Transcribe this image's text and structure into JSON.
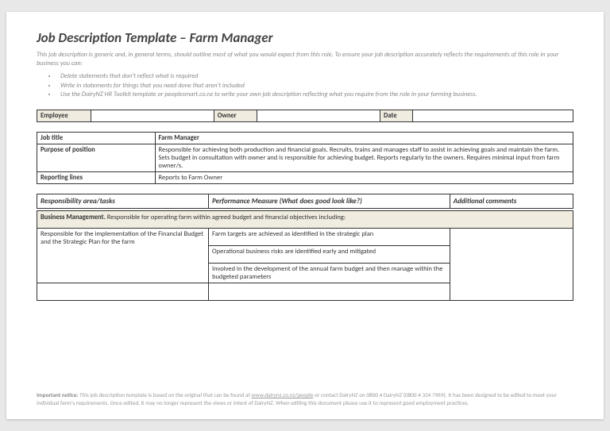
{
  "title": "Job Description Template – Farm Manager",
  "intro": "This job description is generic and, in general terms, should outline most of what you would expect from this role. To ensure your job description accurately reflects the requirements of this role in your business you can:",
  "guide": [
    "Delete statements that don't reflect what is required",
    "Write in statements for things that you need done that aren't included",
    "Use the DairyNZ HR Toolkit template or peoplesmart.co.nz to write your own job description reflecting what you require from the role in your farming business."
  ],
  "t1": {
    "employee": "Employee",
    "owner": "Owner",
    "date": "Date"
  },
  "t2": {
    "job_title_k": "Job title",
    "job_title_v": "Farm Manager",
    "purpose_k": "Purpose of position",
    "purpose_v": "Responsible for achieving both production and financial goals.  Recruits, trains and manages staff to assist in achieving goals and maintain the farm.  Sets budget in consultation with owner and is responsible for achieving budget.  Reports regularly to the owners. Requires minimal input from farm owner/s.",
    "reporting_k": "Reporting lines",
    "reporting_v": "Reports to Farm Owner"
  },
  "t3": {
    "h1": "Responsibility area/tasks",
    "h2": "Performance Measure (What does good look like?)",
    "h3": "Additional comments",
    "sub_b": "Business Management.",
    "sub_t": " Responsible for operating farm within agreed budget and financial objectives including:",
    "r1a": "Responsible for the implementation of the Financial Budget and the Strategic Plan for the farm",
    "r1b": "Farm targets are achieved as identified in the strategic plan",
    "r2b": "Operational  business risks are identified early and mitigated",
    "r3b": "Involved in the development of the annual farm budget and then manage within the budgeted parameters"
  },
  "footer": {
    "b": "Important notice:",
    "t1": "   This job description template is based on the original that can be found at ",
    "link": "www.dairynz.co.nz/people",
    "t2": " or contact DairyNZ on 0800 4 DairyNZ (0800 4 324 7969).  It has been designed to be edited to meet your individual farm's requirements.  Once edited, it may no longer represent the views or intent of DairyNZ.  When editing this document please use it to represent good employment practices."
  }
}
